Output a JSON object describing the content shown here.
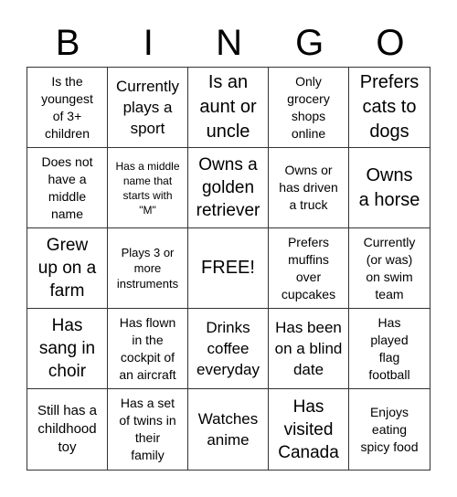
{
  "header": [
    "B",
    "I",
    "N",
    "G",
    "O"
  ],
  "cells": [
    "Is the\nyoungest\nof 3+\nchildren",
    "Currently\nplays a\nsport",
    "Is an\naunt or\nuncle",
    "Only\ngrocery\nshops\nonline",
    "Prefers\ncats to\ndogs",
    "Does not\nhave a\nmiddle\nname",
    "Has a middle\nname that\nstarts with\n\"M\"",
    "Owns a\ngolden\nretriever",
    "Owns or\nhas driven\na truck",
    "Owns\na horse",
    "Grew\nup on a\nfarm",
    "Plays 3 or\nmore\ninstruments",
    "FREE!",
    "Prefers\nmuffins\nover\ncupcakes",
    "Currently\n(or was)\non swim\nteam",
    "Has\nsang in\nchoir",
    "Has flown\nin the\ncockpit of\nan aircraft",
    "Drinks\ncoffee\neveryday",
    "Has been\non a blind\ndate",
    "Has\nplayed\nflag\nfootball",
    "Still has a\nchildhood\ntoy",
    "Has a set\nof twins in\ntheir\nfamily",
    "Watches\nanime",
    "Has\nvisited\nCanada",
    "Enjoys\neating\nspicy food"
  ]
}
